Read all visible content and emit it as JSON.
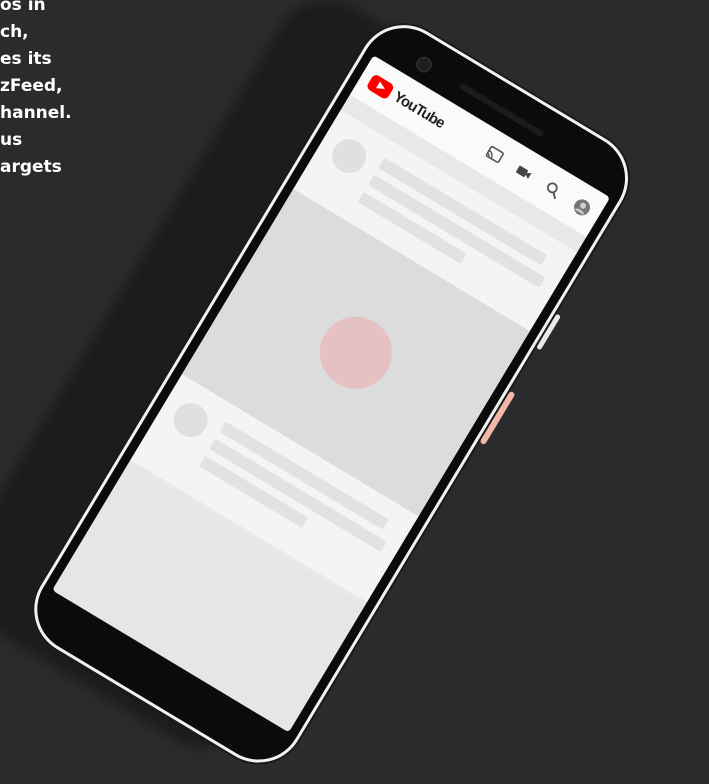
{
  "caption": {
    "lines": [
      "os in",
      "ch,",
      "es its",
      "zFeed,",
      "hannel.",
      "us",
      "argets"
    ],
    "color": "#ffffff"
  },
  "background_color": "#2b2b2d",
  "phone": {
    "frame_color": "#0b0b0b",
    "bezel_color": "#f2f2f2",
    "side_button_color": "#f4b6a8"
  },
  "app": {
    "logo_text": "YouTube",
    "logo_icon": "youtube-play-icon",
    "brand_color": "#ff0000",
    "header_icons": [
      "cast-icon",
      "camera-icon",
      "search-icon",
      "account-avatar-icon"
    ]
  }
}
